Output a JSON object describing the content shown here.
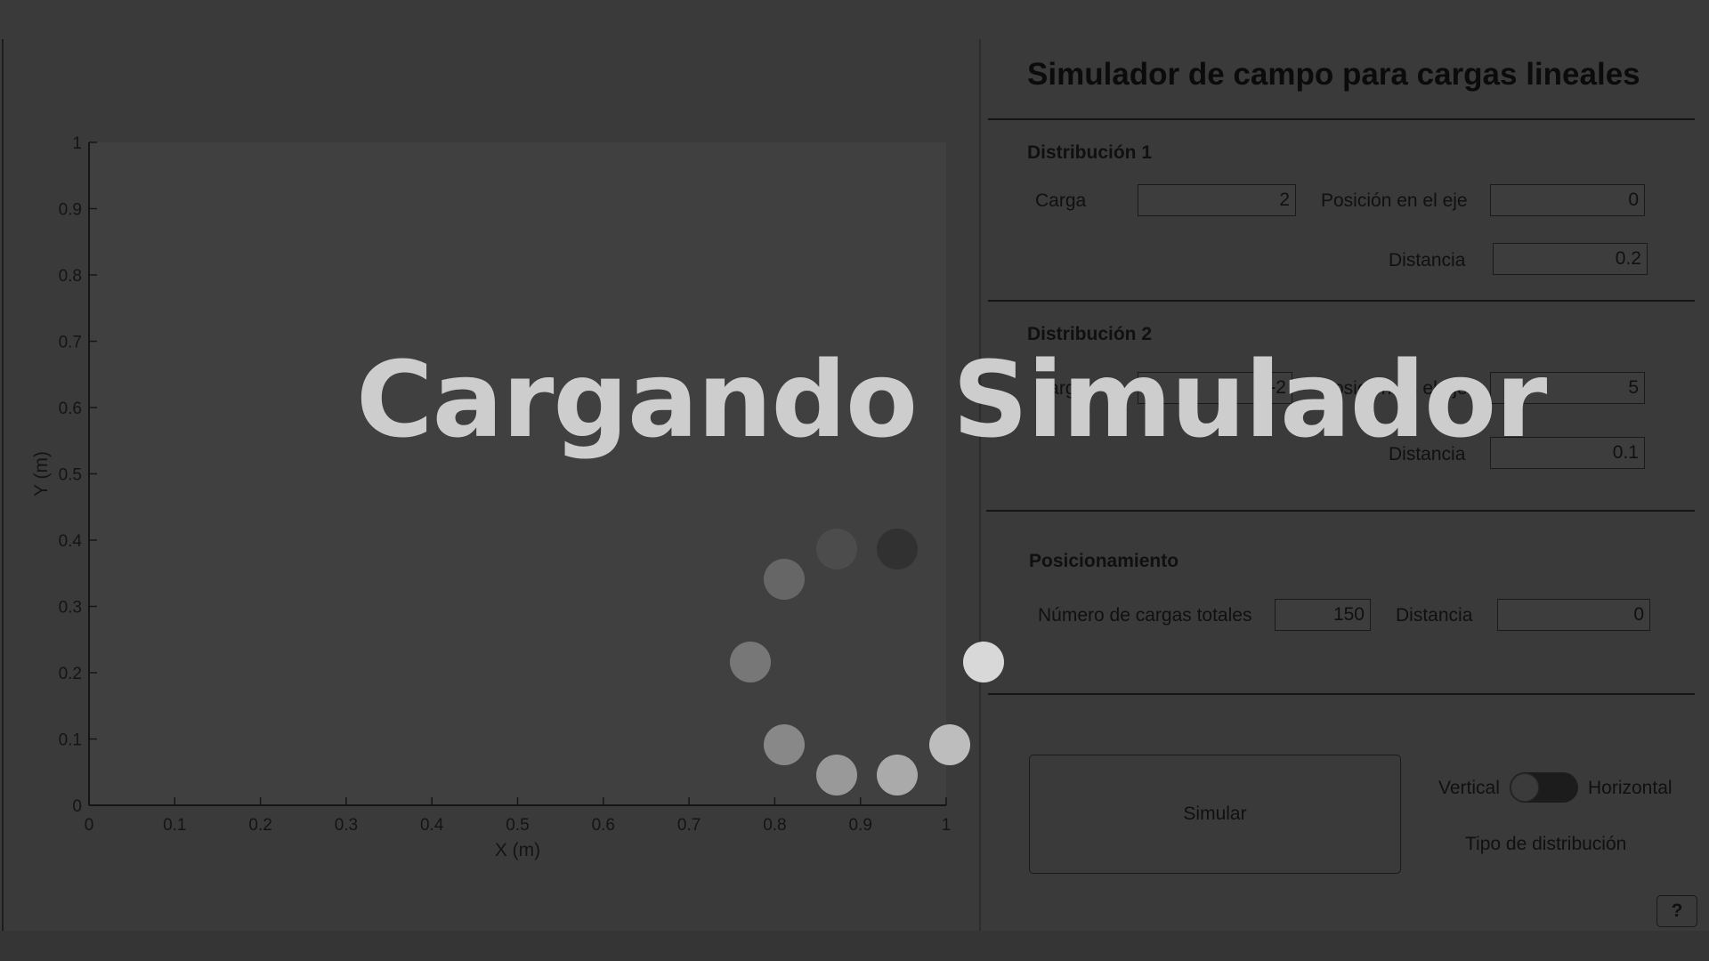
{
  "plot": {
    "xlabel": "X (m)",
    "ylabel": "Y (m)",
    "x_ticks": [
      "0",
      "0.1",
      "0.2",
      "0.3",
      "0.4",
      "0.5",
      "0.6",
      "0.7",
      "0.8",
      "0.9",
      "1"
    ],
    "y_ticks": [
      "0",
      "0.1",
      "0.2",
      "0.3",
      "0.4",
      "0.5",
      "0.6",
      "0.7",
      "0.8",
      "0.9",
      "1"
    ],
    "xlim": [
      0,
      1
    ],
    "ylim": [
      0,
      1
    ]
  },
  "panel": {
    "title": "Simulador de campo para cargas lineales",
    "dist1": {
      "title": "Distribución 1",
      "carga_label": "Carga",
      "carga_value": "2",
      "posicion_label": "Posición en el eje",
      "posicion_value": "0",
      "distancia_label": "Distancia",
      "distancia_value": "0.2"
    },
    "dist2": {
      "title": "Distribución 2",
      "carga_label": "Carga",
      "carga_value": "-2",
      "posicion_label": "Posición en el eje",
      "posicion_value": "5",
      "distancia_label": "Distancia",
      "distancia_value": "0.1"
    },
    "posicionamiento": {
      "title": "Posicionamiento",
      "num_label": "Número de cargas totales",
      "num_value": "150",
      "distancia_label": "Distancia",
      "distancia_value": "0"
    },
    "simular_label": "Simular",
    "toggle": {
      "left_label": "Vertical",
      "right_label": "Horizontal",
      "caption": "Tipo de distribución",
      "state": "Vertical"
    },
    "help_label": "?"
  },
  "overlay": {
    "text": "Cargando Simulador",
    "spinner_colors": [
      "#313131",
      "#4c4c4c",
      "#666666",
      "#777777",
      "#888888",
      "#999999",
      "#aaaaaa",
      "#bdbdbd",
      "#d8d8d8"
    ]
  },
  "colors": {
    "background": "#3a3a3a",
    "plot_background": "#404040",
    "overlay_text": "#cdcdcd"
  }
}
